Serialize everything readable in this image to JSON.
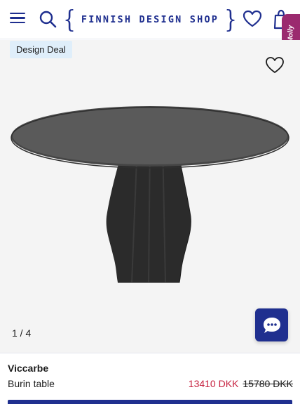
{
  "header": {
    "logo_text": "FINNISH DESIGN SHOP",
    "icons": {
      "menu": "hamburger-menu-icon",
      "search": "search-icon",
      "wishlist": "heart-icon",
      "cart": "shopping-bag-icon"
    },
    "accent_color": "#1f2f8f"
  },
  "assistant_tab": {
    "label": "Molly",
    "color": "#9b2a6f"
  },
  "gallery": {
    "badge": "Design Deal",
    "counter": "1 / 4",
    "chat_icon": "chat-bubble-icon"
  },
  "product": {
    "brand": "Viccarbe",
    "name": "Burin table",
    "sale_price": "13410 DKK",
    "original_price": "15780 DKK",
    "sale_color": "#c6213f"
  }
}
